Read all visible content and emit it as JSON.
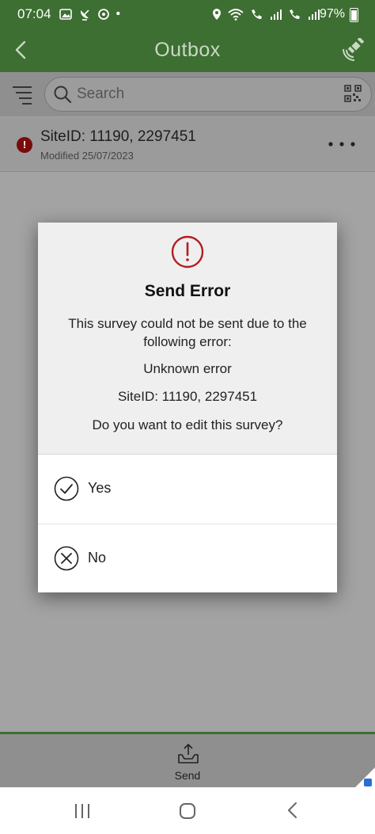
{
  "status_bar": {
    "time": "07:04",
    "battery": "97%",
    "notification_dot": "•"
  },
  "app_bar": {
    "title": "Outbox"
  },
  "search": {
    "placeholder": "Search"
  },
  "list": {
    "items": [
      {
        "title": "SiteID: 11190, 2297451",
        "subtitle": "Modified 25/07/2023",
        "badge": "!"
      }
    ]
  },
  "dialog": {
    "title": "Send Error",
    "message": "This survey could not be sent due to the following error:",
    "error": "Unknown error",
    "site": "SiteID: 11190, 2297451",
    "question": "Do you want to edit this survey?",
    "yes_label": "Yes",
    "no_label": "No"
  },
  "bottom_bar": {
    "send_label": "Send"
  },
  "colors": {
    "accent": "#3d6e32",
    "error": "#b21e1e"
  }
}
